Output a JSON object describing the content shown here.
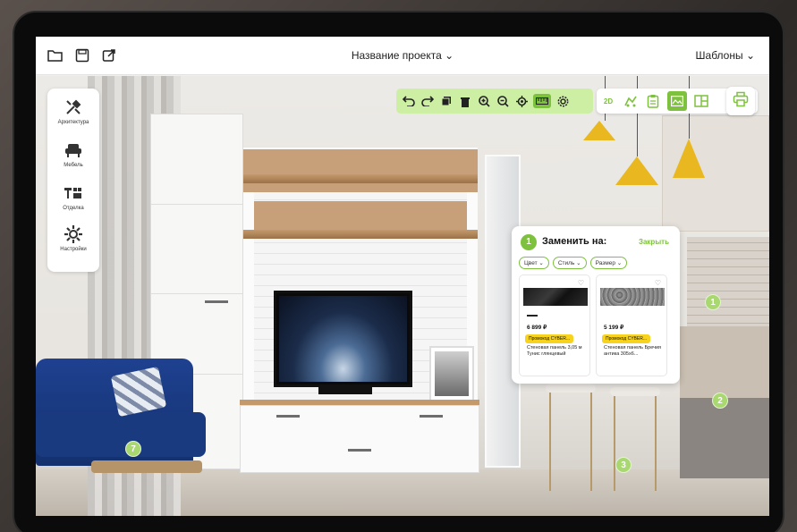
{
  "header": {
    "project_title": "Название проекта",
    "templates_label": "Шаблоны",
    "file_actions": [
      {
        "icon": "folder-open-icon"
      },
      {
        "icon": "save-icon"
      },
      {
        "icon": "export-icon"
      }
    ]
  },
  "sidebar": {
    "items": [
      {
        "label": "Архитектура",
        "icon": "tools-icon"
      },
      {
        "label": "Мебель",
        "icon": "armchair-icon"
      },
      {
        "label": "Отделка",
        "icon": "finishing-icon"
      },
      {
        "label": "Настройки",
        "icon": "gear-icon"
      }
    ]
  },
  "toolbar": {
    "view_2d_label": "2D",
    "tools": [
      "undo-icon",
      "redo-icon",
      "copy-icon",
      "delete-icon",
      "zoom-in-icon",
      "zoom-out-icon",
      "target-icon",
      "ruler-icon",
      "settings-icon"
    ]
  },
  "replace_panel": {
    "step": "1",
    "title": "Заменить на:",
    "close_label": "Закрыть",
    "filters": [
      "Цвет",
      "Стиль",
      "Размер"
    ],
    "cards": [
      {
        "price": "6 899 ₽",
        "promo": "Промокод CYBER...",
        "name": "Стеновая панель 3,05 м Тунис глянцевый"
      },
      {
        "price": "5 199 ₽",
        "promo": "Промокод CYBER...",
        "name": "Стеновая панель Бречия антика 305х6..."
      }
    ]
  },
  "markers": [
    "1",
    "2",
    "3",
    "7"
  ],
  "colors": {
    "accent": "#7ec13f",
    "accent_light": "#ccefa3",
    "promo": "#f8d31e"
  }
}
